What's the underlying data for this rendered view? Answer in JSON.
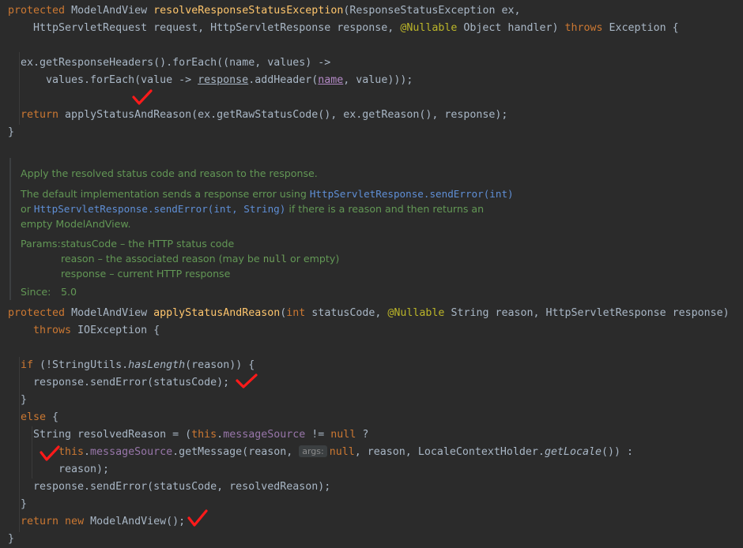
{
  "method1": {
    "kw_protected": "protected",
    "ret_type": "ModelAndView",
    "name": "resolveResponseStatusException",
    "params_a": "(ResponseStatusException ex,",
    "params_b1": "HttpServletRequest request, HttpServletResponse response, ",
    "nullable": "@Nullable",
    "params_b2": " Object handler) ",
    "kw_throws": "throws",
    "params_b3": " Exception {",
    "stmt1a": "ex.getResponseHeaders().forEach((name, values) ->",
    "stmt2a": "values.forEach(value -> ",
    "stmt2_response": "response",
    "stmt2b": ".addHeader(",
    "stmt2_name": "name",
    "stmt2c": ", value)));",
    "kw_return": "return",
    "stmt3": " applyStatusAndReason(ex.getRawStatusCode(), ex.getReason(), response);",
    "close": "}"
  },
  "javadoc": {
    "summary": "Apply the resolved status code and reason to the response.",
    "desc1a": "The default implementation sends a response error using ",
    "desc1_code": "HttpServletResponse.sendError(int)",
    "desc2a": "or ",
    "desc2_code": "HttpServletResponse.sendError(int, String)",
    "desc2b": " if there is a reason and then returns an",
    "desc3": "empty ModelAndView.",
    "params_label": "Params:",
    "param1": "statusCode – the HTTP status code",
    "param2a": "reason – the associated reason (may be ",
    "param2_null": "null",
    "param2b": " or empty)",
    "param3": "response – current HTTP response",
    "since_label": "Since:",
    "since_value": "5.0"
  },
  "method2": {
    "kw_protected": "protected",
    "ret_type": " ModelAndView ",
    "name": "applyStatusAndReason",
    "p_open": "(",
    "kw_int": "int",
    "p1": " statusCode, ",
    "nullable": "@Nullable",
    "p2": " String reason, HttpServletResponse response)",
    "kw_throws": "throws",
    "p3": " IOException {",
    "kw_if": "if",
    "if_a": " (!StringUtils.",
    "if_has": "hasLength",
    "if_b": "(reason)) {",
    "send1": "response.sendError(statusCode);",
    "close_brace": "}",
    "kw_else": "else",
    "else_b": " {",
    "rr_a": "String resolvedReason = (",
    "kw_this": "this",
    "dot": ".",
    "field": "messageSource",
    "rr_b": " != ",
    "kw_null": "null",
    "rr_c": " ?",
    "gm_a": ".getMessage(reason, ",
    "hint_args": "args:",
    "gm_b": ", reason, LocaleContextHolder.",
    "gm_locale": "getLocale",
    "gm_c": "()) :",
    "reason_line": "reason);",
    "send2": "response.sendError(statusCode, resolvedReason);",
    "kw_return": "return",
    "kw_new": " new",
    "ret_b": " ModelAndView();",
    "final_close": "}"
  },
  "colors": {
    "background": "#2b2b2b",
    "keyword": "#cc7832",
    "method": "#ffc66d",
    "annotation": "#bbb529",
    "field": "#9876aa",
    "doc": "#629755",
    "check": "#ff1a1a"
  }
}
